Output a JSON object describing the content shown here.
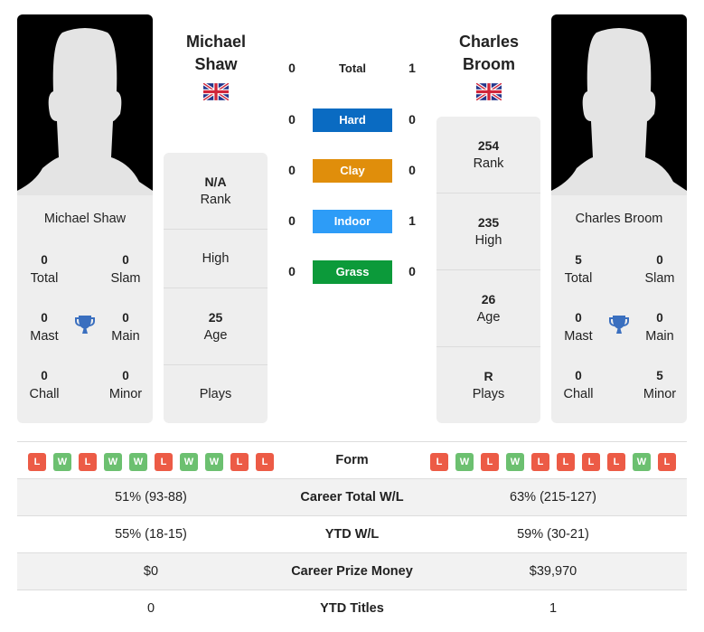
{
  "colors": {
    "hard": "#0a6bc2",
    "clay": "#e08e0b",
    "indoor": "#2d9cf7",
    "grass": "#0c9a3a",
    "loss": "#ec5b46",
    "win": "#6cc070",
    "trophy": "#3a6fbf"
  },
  "player1": {
    "name": "Michael Shaw",
    "name_line1": "Michael",
    "name_line2": "Shaw",
    "flag": "uk-flag-icon",
    "titles": {
      "total": {
        "value": "0",
        "label": "Total"
      },
      "slam": {
        "value": "0",
        "label": "Slam"
      },
      "mast": {
        "value": "0",
        "label": "Mast"
      },
      "main": {
        "value": "0",
        "label": "Main"
      },
      "chall": {
        "value": "0",
        "label": "Chall"
      },
      "minor": {
        "value": "0",
        "label": "Minor"
      }
    },
    "stats": {
      "rank": {
        "value": "N/A",
        "label": "Rank"
      },
      "high": {
        "value": "",
        "label": "High"
      },
      "age": {
        "value": "25",
        "label": "Age"
      },
      "plays": {
        "value": "",
        "label": "Plays"
      }
    },
    "form": [
      "L",
      "W",
      "L",
      "W",
      "W",
      "L",
      "W",
      "W",
      "L",
      "L"
    ],
    "career_wl": "51% (93-88)",
    "ytd_wl": "55% (18-15)",
    "prize_money": "$0",
    "ytd_titles": "0"
  },
  "player2": {
    "name": "Charles Broom",
    "name_line1": "Charles",
    "name_line2": "Broom",
    "flag": "uk-flag-icon",
    "titles": {
      "total": {
        "value": "5",
        "label": "Total"
      },
      "slam": {
        "value": "0",
        "label": "Slam"
      },
      "mast": {
        "value": "0",
        "label": "Mast"
      },
      "main": {
        "value": "0",
        "label": "Main"
      },
      "chall": {
        "value": "0",
        "label": "Chall"
      },
      "minor": {
        "value": "5",
        "label": "Minor"
      }
    },
    "stats": {
      "rank": {
        "value": "254",
        "label": "Rank"
      },
      "high": {
        "value": "235",
        "label": "High"
      },
      "age": {
        "value": "26",
        "label": "Age"
      },
      "plays": {
        "value": "R",
        "label": "Plays"
      }
    },
    "form": [
      "L",
      "W",
      "L",
      "W",
      "L",
      "L",
      "L",
      "L",
      "W",
      "L"
    ],
    "career_wl": "63% (215-127)",
    "ytd_wl": "59% (30-21)",
    "prize_money": "$39,970",
    "ytd_titles": "1"
  },
  "h2h": [
    {
      "label": "Total",
      "p1": "0",
      "p2": "1"
    },
    {
      "label": "Hard",
      "p1": "0",
      "p2": "0"
    },
    {
      "label": "Clay",
      "p1": "0",
      "p2": "0"
    },
    {
      "label": "Indoor",
      "p1": "0",
      "p2": "1"
    },
    {
      "label": "Grass",
      "p1": "0",
      "p2": "0"
    }
  ],
  "table_labels": {
    "form": "Form",
    "career_wl": "Career Total W/L",
    "ytd_wl": "YTD W/L",
    "prize_money": "Career Prize Money",
    "ytd_titles": "YTD Titles"
  }
}
